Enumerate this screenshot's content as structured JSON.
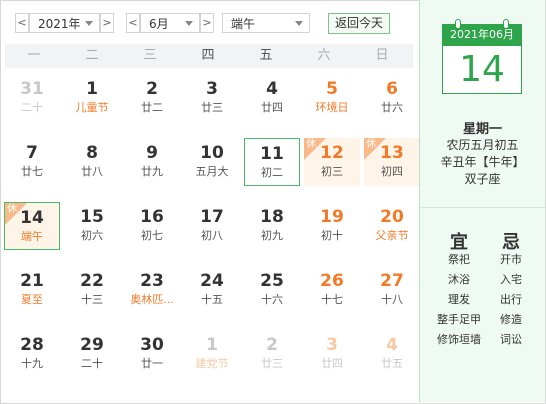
{
  "toolbar": {
    "year": "2021年",
    "month": "6月",
    "holiday": "端午",
    "today_button": "返回今天",
    "prev": "<",
    "next": ">"
  },
  "weekdays": [
    "一",
    "二",
    "三",
    "四",
    "五",
    "六",
    "日"
  ],
  "weeks": [
    [
      {
        "num": "31",
        "lunar": "二十",
        "flags": [
          "other"
        ]
      },
      {
        "num": "1",
        "lunar": "儿童节",
        "flags": [
          "festival"
        ]
      },
      {
        "num": "2",
        "lunar": "廿二",
        "flags": []
      },
      {
        "num": "3",
        "lunar": "廿三",
        "flags": []
      },
      {
        "num": "4",
        "lunar": "廿四",
        "flags": []
      },
      {
        "num": "5",
        "lunar": "环境日",
        "flags": [
          "holiday",
          "festival"
        ]
      },
      {
        "num": "6",
        "lunar": "廿六",
        "flags": [
          "holiday"
        ]
      }
    ],
    [
      {
        "num": "7",
        "lunar": "廿七",
        "flags": []
      },
      {
        "num": "8",
        "lunar": "廿八",
        "flags": []
      },
      {
        "num": "9",
        "lunar": "廿九",
        "flags": []
      },
      {
        "num": "10",
        "lunar": "五月大",
        "flags": []
      },
      {
        "num": "11",
        "lunar": "初二",
        "flags": [
          "selected"
        ]
      },
      {
        "num": "12",
        "lunar": "初三",
        "flags": [
          "holiday",
          "restday"
        ],
        "tag": "休"
      },
      {
        "num": "13",
        "lunar": "初四",
        "flags": [
          "holiday",
          "restday"
        ],
        "tag": "休"
      }
    ],
    [
      {
        "num": "14",
        "lunar": "端午",
        "flags": [
          "today",
          "festival"
        ],
        "tag": "休"
      },
      {
        "num": "15",
        "lunar": "初六",
        "flags": []
      },
      {
        "num": "16",
        "lunar": "初七",
        "flags": []
      },
      {
        "num": "17",
        "lunar": "初八",
        "flags": []
      },
      {
        "num": "18",
        "lunar": "初九",
        "flags": []
      },
      {
        "num": "19",
        "lunar": "初十",
        "flags": [
          "holiday"
        ]
      },
      {
        "num": "20",
        "lunar": "父亲节",
        "flags": [
          "holiday",
          "festival"
        ]
      }
    ],
    [
      {
        "num": "21",
        "lunar": "夏至",
        "flags": [
          "festival"
        ]
      },
      {
        "num": "22",
        "lunar": "十三",
        "flags": []
      },
      {
        "num": "23",
        "lunar": "奥林匹...",
        "flags": [
          "festival"
        ]
      },
      {
        "num": "24",
        "lunar": "十五",
        "flags": []
      },
      {
        "num": "25",
        "lunar": "十六",
        "flags": []
      },
      {
        "num": "26",
        "lunar": "十七",
        "flags": [
          "holiday"
        ]
      },
      {
        "num": "27",
        "lunar": "十八",
        "flags": [
          "holiday"
        ]
      }
    ],
    [
      {
        "num": "28",
        "lunar": "十九",
        "flags": []
      },
      {
        "num": "29",
        "lunar": "二十",
        "flags": []
      },
      {
        "num": "30",
        "lunar": "廿一",
        "flags": []
      },
      {
        "num": "1",
        "lunar": "建党节",
        "flags": [
          "other",
          "festival"
        ]
      },
      {
        "num": "2",
        "lunar": "廿三",
        "flags": [
          "other"
        ]
      },
      {
        "num": "3",
        "lunar": "廿四",
        "flags": [
          "other",
          "holiday"
        ]
      },
      {
        "num": "4",
        "lunar": "廿五",
        "flags": [
          "other",
          "holiday"
        ]
      }
    ]
  ],
  "panel": {
    "card_header": "2021年06月",
    "card_day": "14",
    "weekday": "星期一",
    "lunar_date": "农历五月初五",
    "ganzhi": "辛丑年【牛年】",
    "constellation": "双子座",
    "yi_title": "宜",
    "ji_title": "忌",
    "yi": [
      "祭祀",
      "沐浴",
      "理发",
      "整手足甲",
      "修饰垣墙"
    ],
    "ji": [
      "开市",
      "入宅",
      "出行",
      "修造",
      "词讼"
    ]
  },
  "colors": {
    "accent_green": "#2fa54b",
    "holiday_orange": "#f27a26",
    "rest_bg": "#fff4e8"
  }
}
